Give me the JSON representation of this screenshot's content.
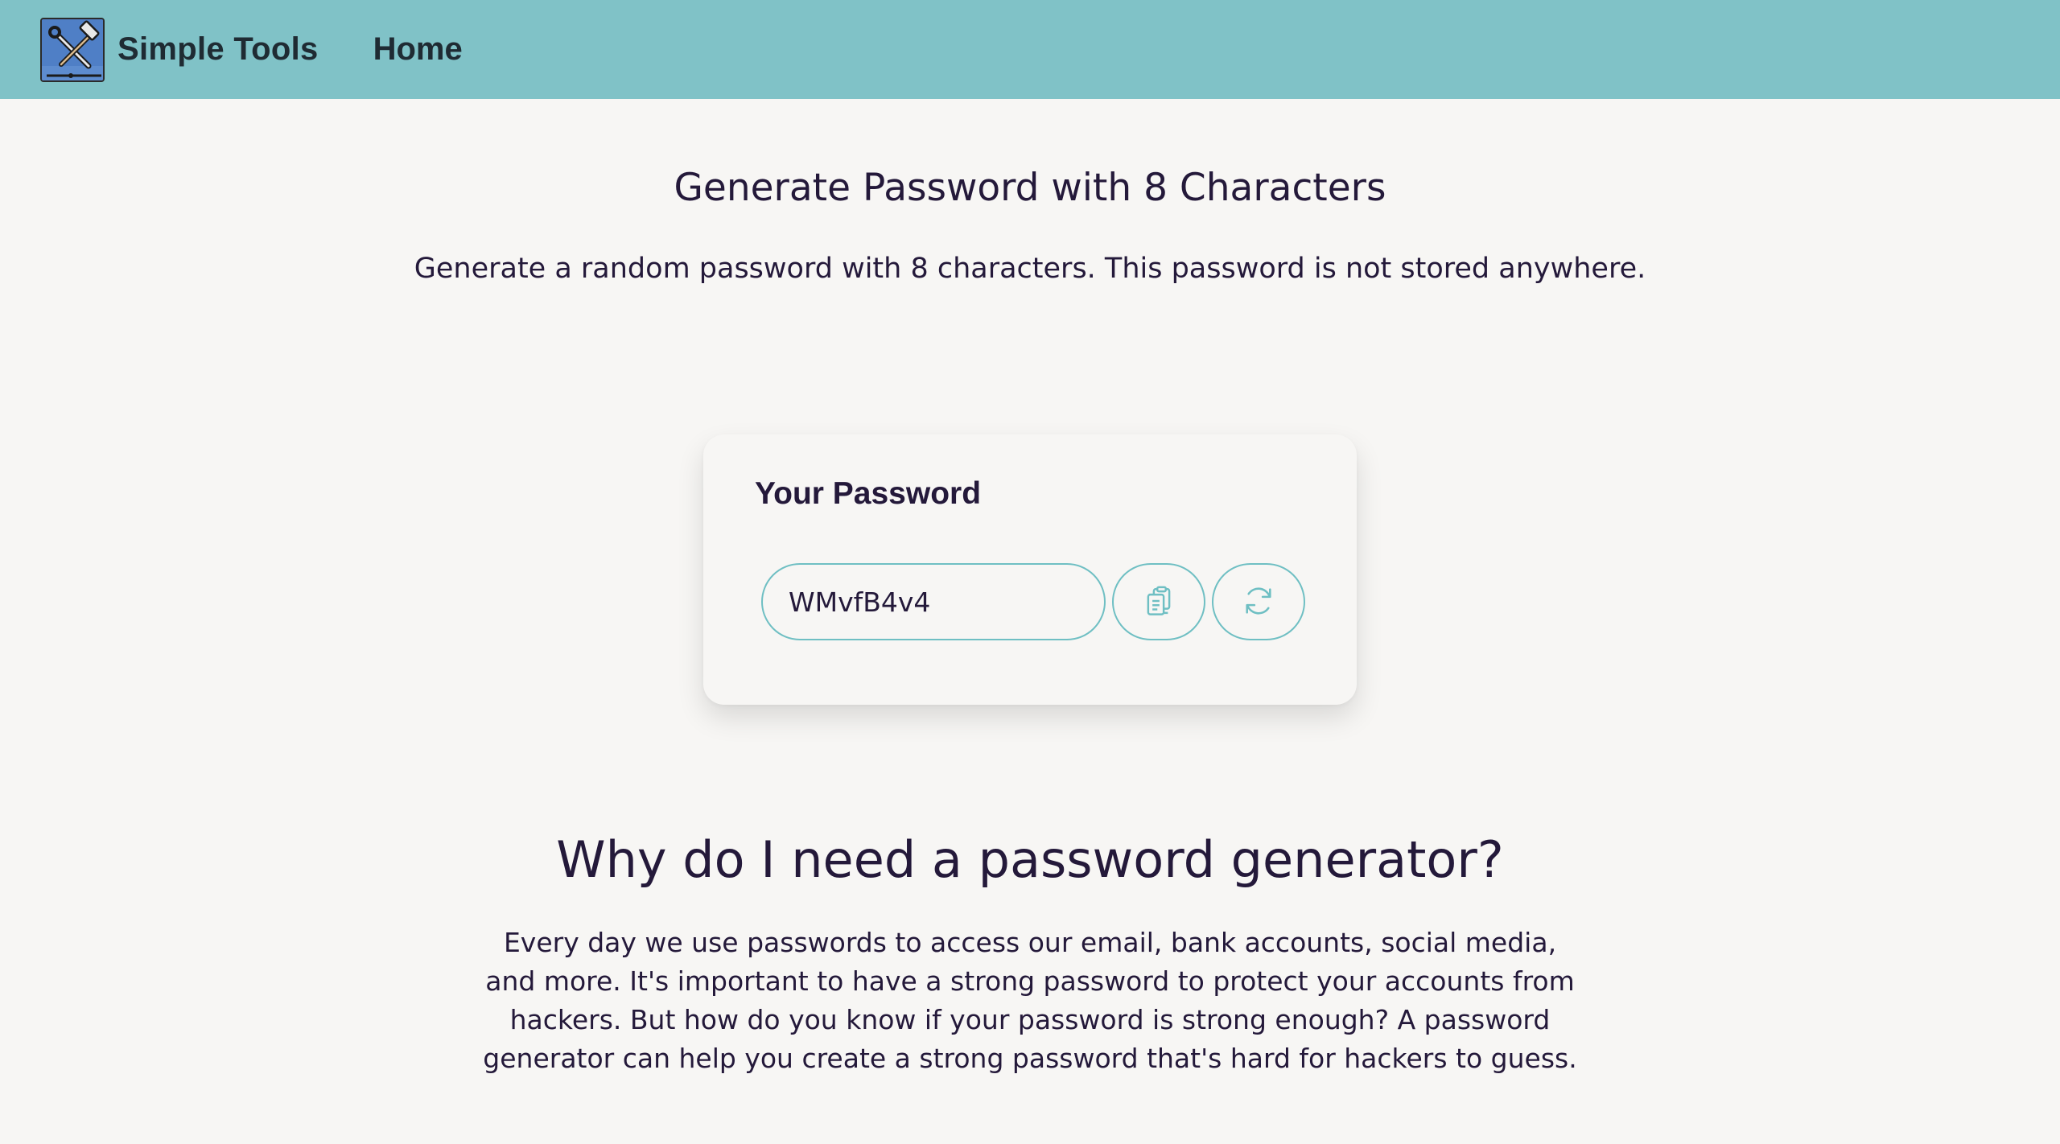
{
  "nav": {
    "brand_name": "Simple Tools",
    "home_label": "Home",
    "logo_icon": "tools-icon",
    "bar_color": "#80c2c7"
  },
  "header": {
    "title": "Generate Password with 8 Characters",
    "subtitle": "Generate a random password with 8 characters. This password is not stored anywhere."
  },
  "card": {
    "title": "Your Password",
    "password_value": "WMvfB4v4",
    "copy_icon": "clipboard-icon",
    "refresh_icon": "refresh-icon",
    "accent_color": "#6fbfc3"
  },
  "section": {
    "heading": "Why do I need a password generator?",
    "body": "Every day we use passwords to access our email, bank accounts, social media, and more. It's important to have a strong password to protect your accounts from hackers. But how do you know if your password is strong enough? A password generator can help you create a strong password that's hard for hackers to guess."
  }
}
